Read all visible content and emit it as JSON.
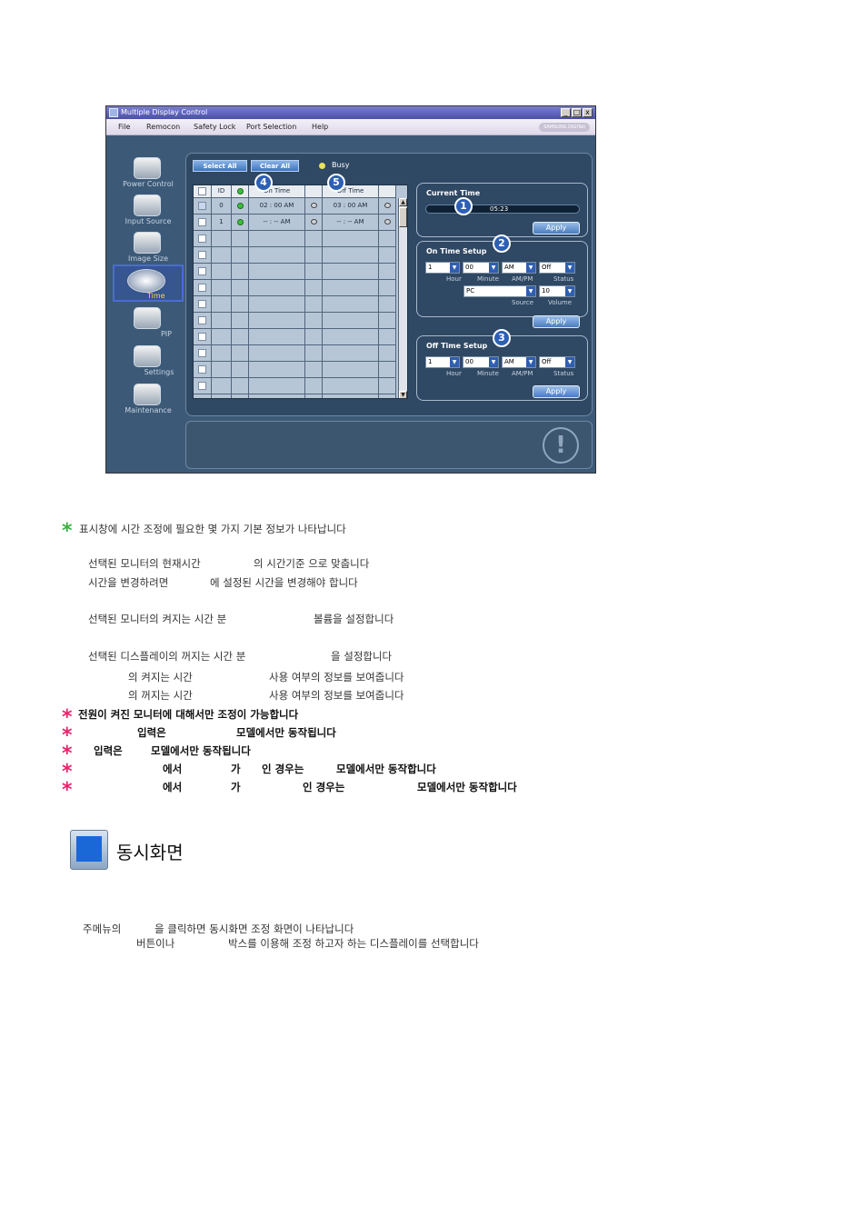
{
  "window": {
    "title": "Multiple Display Control",
    "menu": [
      "File",
      "Remocon",
      "Safety Lock",
      "Port Selection",
      "Help"
    ],
    "brand": "SAMSUNG DIGITall"
  },
  "sidebar": {
    "items": [
      {
        "label": "Power Control"
      },
      {
        "label": "Input Source"
      },
      {
        "label": "Image Size"
      },
      {
        "label": "Time"
      },
      {
        "label": "PIP"
      },
      {
        "label": "Settings"
      },
      {
        "label": "Maintenance"
      }
    ]
  },
  "toolbar": {
    "select_all": "Select All",
    "clear_all": "Clear All",
    "busy": "Busy"
  },
  "grid": {
    "headers": {
      "id": "ID",
      "on_time": "On Time",
      "off_time": "Off Time"
    },
    "rows": [
      {
        "id": "0",
        "on_time": "02 : 00 AM",
        "off_time": "03 : 00 AM"
      },
      {
        "id": "1",
        "on_time": "-- : -- AM",
        "off_time": "-- : -- AM"
      }
    ]
  },
  "current_time": {
    "title": "Current Time",
    "value": "05:23",
    "apply": "Apply"
  },
  "on_time_setup": {
    "title": "On Time Setup",
    "hour": "1",
    "minute": "00",
    "ampm": "AM",
    "status": "Off",
    "source": "PC",
    "volume": "10",
    "labels": {
      "hour": "Hour",
      "minute": "Minute",
      "ampm": "AM/PM",
      "status": "Status",
      "source": "Source",
      "volume": "Volume"
    },
    "apply": "Apply"
  },
  "off_time_setup": {
    "title": "Off Time Setup",
    "hour": "1",
    "minute": "00",
    "ampm": "AM",
    "status": "Off",
    "labels": {
      "hour": "Hour",
      "minute": "Minute",
      "ampm": "AM/PM",
      "status": "Status"
    },
    "apply": "Apply"
  },
  "badges": [
    "1",
    "2",
    "3",
    "4",
    "5"
  ],
  "doc": {
    "intro": "표시창에 시간 조정에 필요한 몇 가지 기본 정보가 나타납니다",
    "p1a": "선택된 모니터의 현재시간",
    "p1b": "의 시간기준 으로 맞춥니다",
    "p1c": "시간을 변경하려면",
    "p1d": "에 설정된 시간을 변경해야 합니다",
    "p2a": "선택된 모니터의 켜지는 시간 분",
    "p2b": "볼륨을 설정합니다",
    "p3a": "선택된 디스플레이의 꺼지는 시간 분",
    "p3b": "을 설정합니다",
    "p4a": "의 켜지는 시간",
    "p4b": "사용 여부의 정보를 보여줍니다",
    "p5a": "의 꺼지는 시간",
    "p5b": "사용 여부의 정보를 보여줍니다",
    "n1": "전원이 켜진 모니터에 대해서만 조정이 가능합니다",
    "n2a": "입력은",
    "n2b": "모델에서만 동작됩니다",
    "n3a": "입력은",
    "n3b": "모델에서만 동작됩니다",
    "n4a": "에서",
    "n4b": "가",
    "n4c": "인 경우는",
    "n4d": "모델에서만 동작합니다",
    "n5a": "에서",
    "n5b": "가",
    "n5c": "인 경우는",
    "n5d": "모델에서만 동작합니다",
    "section_title": "동시화면",
    "s1a": "주메뉴의",
    "s1b": "을 클릭하면 동시화면 조정 화면이 나타납니다",
    "s2a": "버튼이나",
    "s2b": "박스를 이용해 조정 하고자 하는 디스플레이를 선택합니다",
    "star": "*"
  }
}
